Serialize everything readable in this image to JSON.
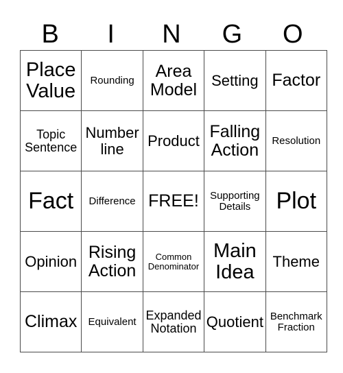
{
  "header": {
    "letters": [
      "B",
      "I",
      "N",
      "G",
      "O"
    ]
  },
  "card": {
    "rows": [
      [
        "Place Value",
        "Rounding",
        "Area Model",
        "Setting",
        "Factor"
      ],
      [
        "Topic Sentence",
        "Number line",
        "Product",
        "Falling Action",
        "Resolution"
      ],
      [
        "Fact",
        "Difference",
        "FREE!",
        "Supporting Details",
        "Plot"
      ],
      [
        "Opinion",
        "Rising Action",
        "Common Denominator",
        "Main Idea",
        "Theme"
      ],
      [
        "Climax",
        "Equivalent",
        "Expanded Notation",
        "Quotient",
        "Benchmark Fraction"
      ]
    ]
  }
}
